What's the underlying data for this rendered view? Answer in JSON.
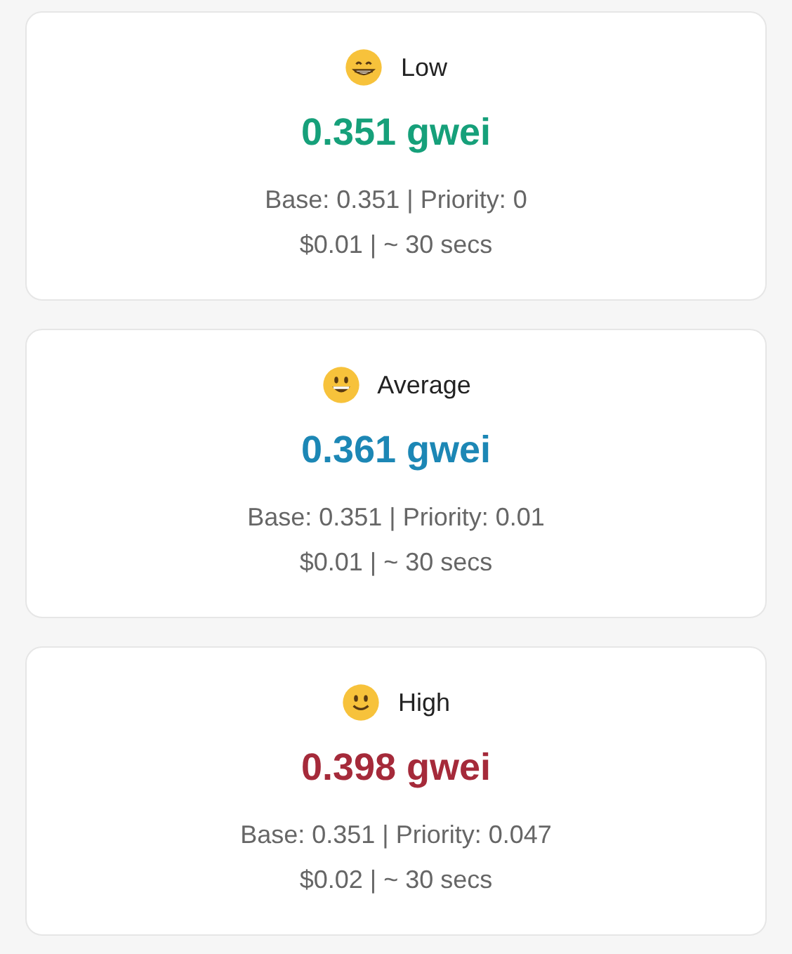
{
  "tiers": [
    {
      "kind": "grin",
      "label": "Low",
      "price": "0.351 gwei",
      "color": "#16a07a",
      "breakdown": "Base: 0.351 | Priority: 0",
      "cost": "$0.01 | ~ 30 secs"
    },
    {
      "kind": "grin-open",
      "label": "Average",
      "price": "0.361 gwei",
      "color": "#1c87b5",
      "breakdown": "Base: 0.351 | Priority: 0.01",
      "cost": "$0.01 | ~ 30 secs"
    },
    {
      "kind": "smile",
      "label": "High",
      "price": "0.398 gwei",
      "color": "#a52a3a",
      "breakdown": "Base: 0.351 | Priority: 0.047",
      "cost": "$0.02 | ~ 30 secs"
    }
  ]
}
